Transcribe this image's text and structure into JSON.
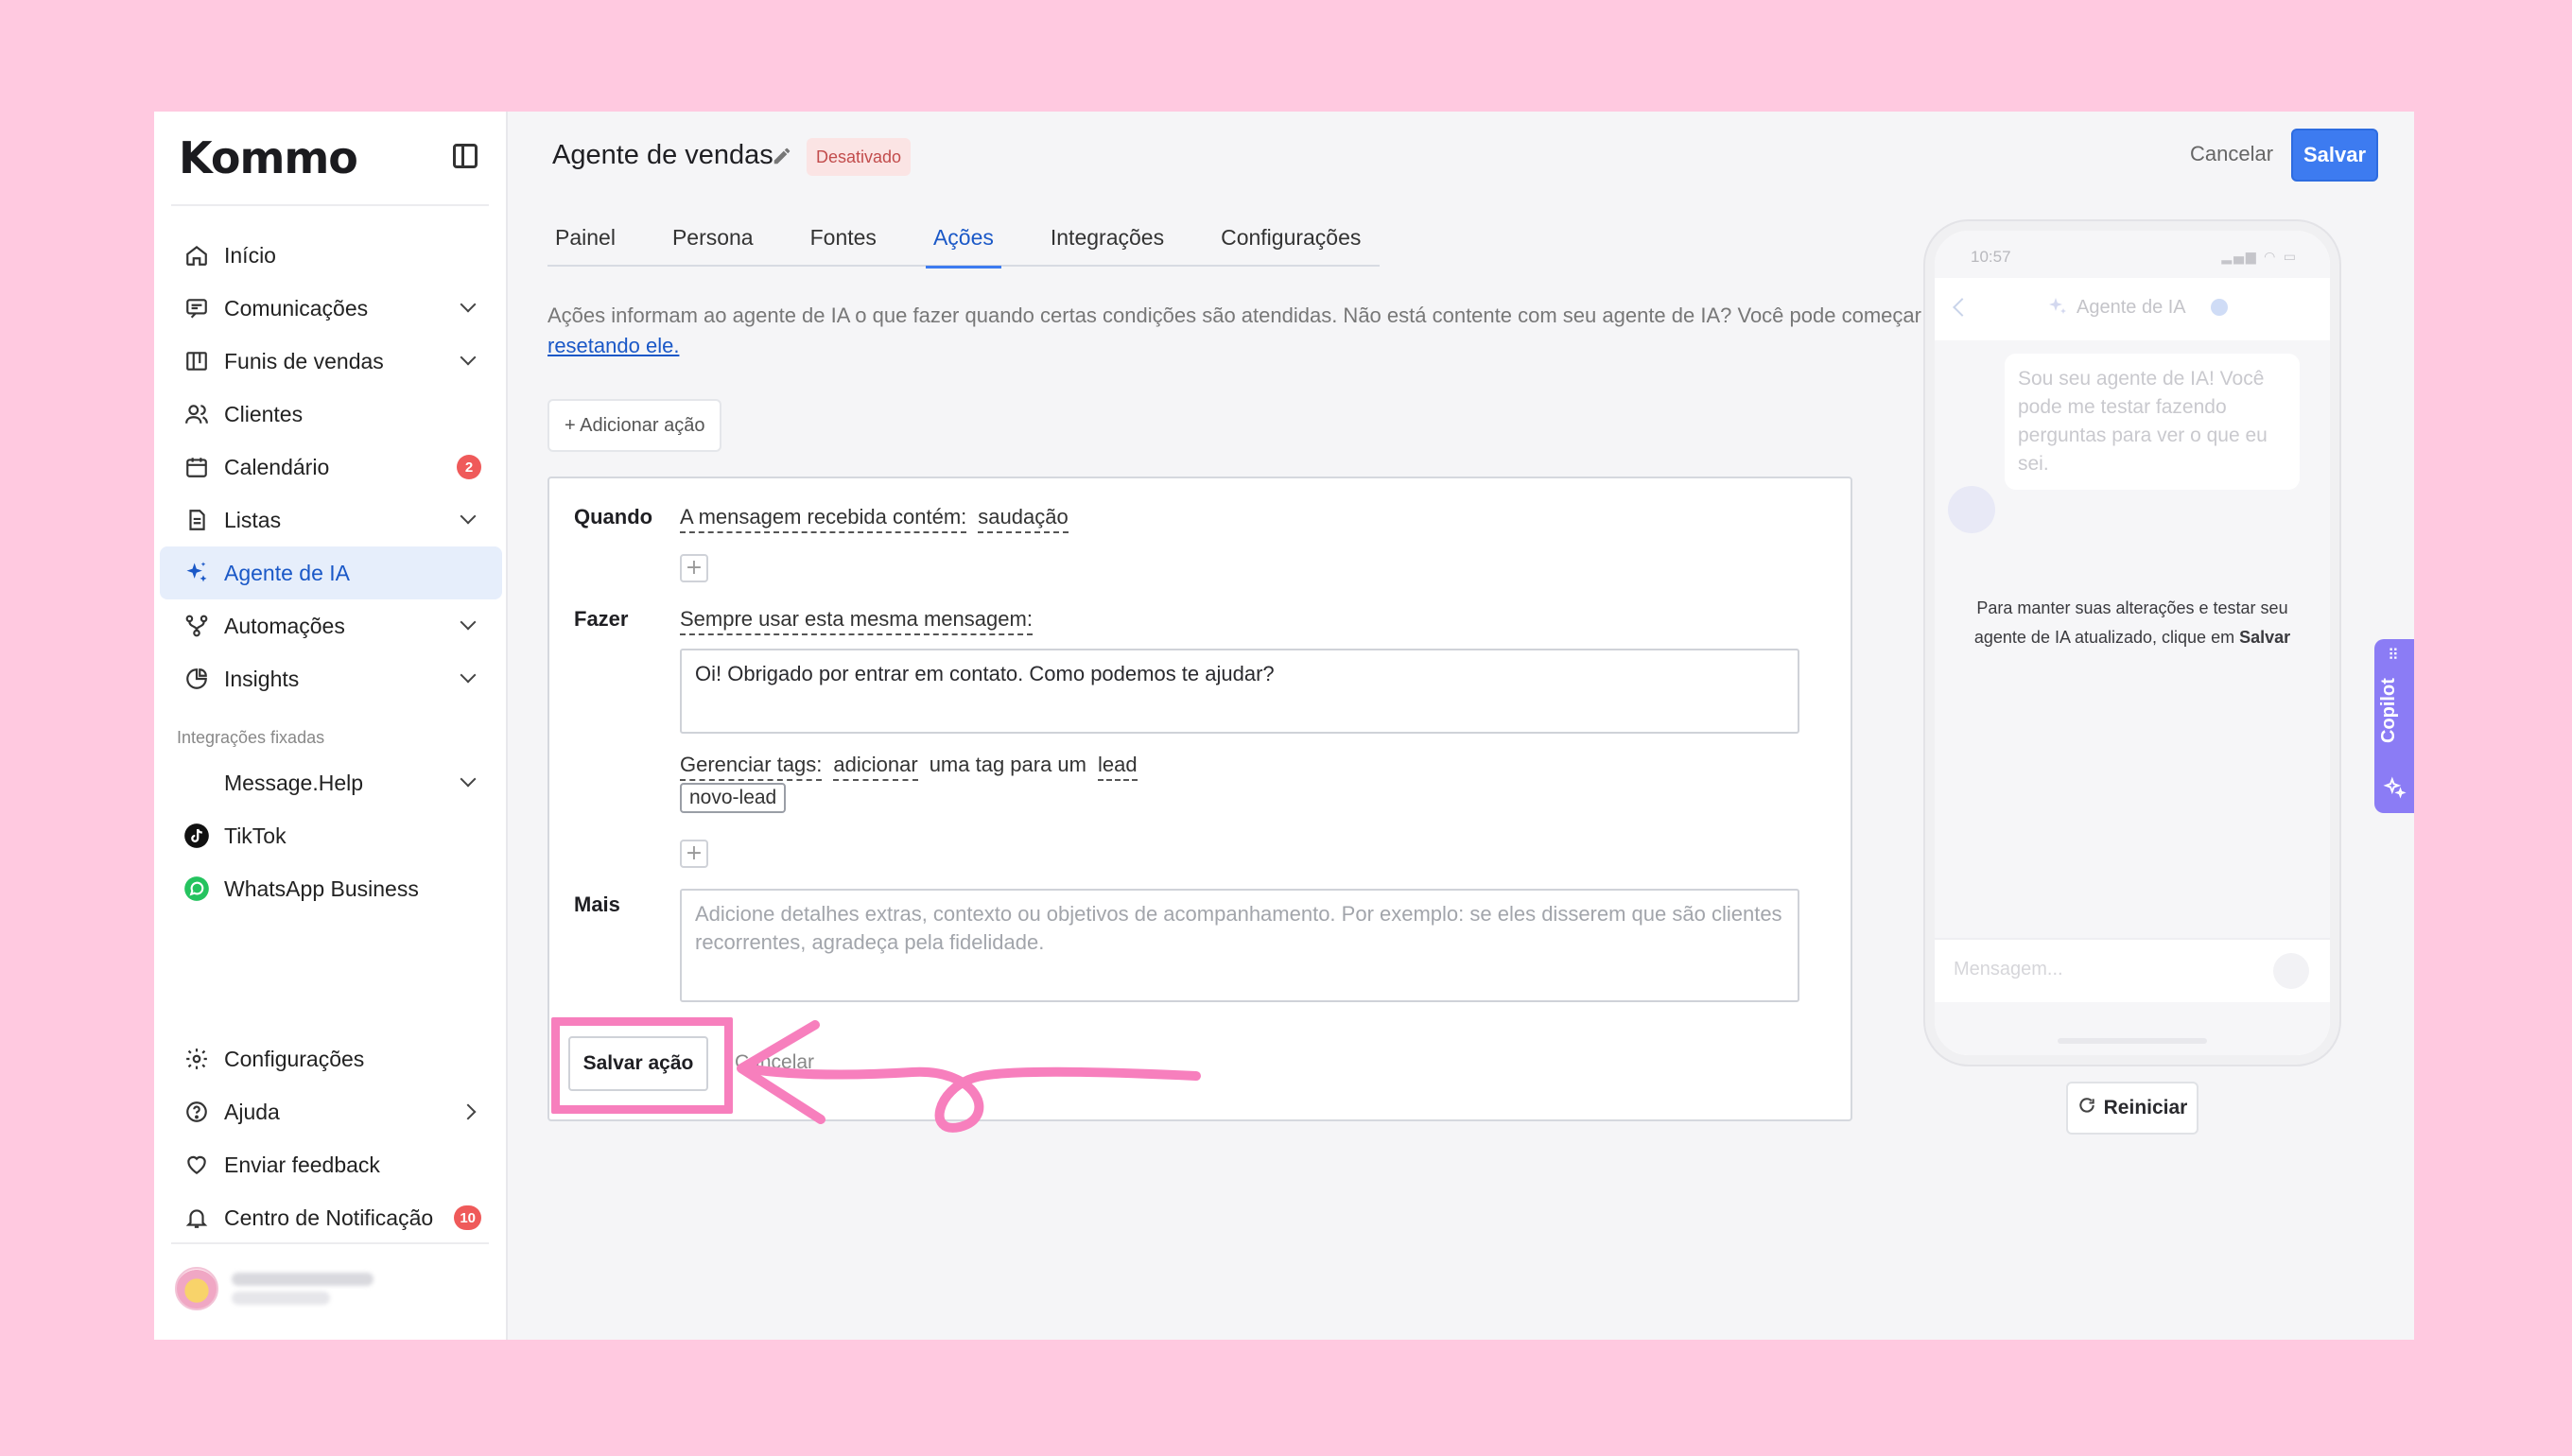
{
  "brand": {
    "logo_text": "Kommo"
  },
  "sidebar": {
    "main_items": [
      {
        "label": "Início",
        "icon": "home-icon"
      },
      {
        "label": "Comunicações",
        "icon": "chat-icon",
        "chevron": true
      },
      {
        "label": "Funis de vendas",
        "icon": "pipeline-icon",
        "chevron": true
      },
      {
        "label": "Clientes",
        "icon": "users-icon"
      },
      {
        "label": "Calendário",
        "icon": "calendar-icon",
        "badge": "2"
      },
      {
        "label": "Listas",
        "icon": "list-icon",
        "chevron": true
      },
      {
        "label": "Agente de IA",
        "icon": "sparkle-icon",
        "active": true
      },
      {
        "label": "Automações",
        "icon": "automation-icon",
        "chevron": true
      },
      {
        "label": "Insights",
        "icon": "pie-chart-icon",
        "chevron": true
      }
    ],
    "pinned_section_label": "Integrações fixadas",
    "pinned_items": [
      {
        "label": "Message.Help",
        "chevron": true
      },
      {
        "label": "TikTok",
        "icon": "tiktok-icon"
      },
      {
        "label": "WhatsApp Business",
        "icon": "whatsapp-icon"
      }
    ],
    "bottom_items": [
      {
        "label": "Configurações",
        "icon": "gear-icon"
      },
      {
        "label": "Ajuda",
        "icon": "help-icon",
        "chevron": true
      },
      {
        "label": "Enviar feedback",
        "icon": "heart-icon"
      },
      {
        "label": "Centro de Notificação",
        "icon": "bell-icon",
        "badge": "10"
      }
    ]
  },
  "header": {
    "title": "Agente de vendas",
    "status": "Desativado",
    "cancel_label": "Cancelar",
    "save_label": "Salvar"
  },
  "tabs": [
    {
      "label": "Painel"
    },
    {
      "label": "Persona"
    },
    {
      "label": "Fontes"
    },
    {
      "label": "Ações",
      "active": true
    },
    {
      "label": "Integrações"
    },
    {
      "label": "Configurações"
    }
  ],
  "description": {
    "text": "Ações informam ao agente de IA o que fazer quando certas condições são atendidas. Não está contente com seu agente de IA? Você pode começar do zero ",
    "link": "resetando ele."
  },
  "add_action_label": "+ Adicionar ação",
  "action_card": {
    "when_label": "Quando",
    "when_condition": "A mensagem recebida contém:",
    "when_value": "saudação",
    "do_label": "Fazer",
    "do_instruction": "Sempre usar esta mesma mensagem:",
    "do_message": "Oi! Obrigado por entrar em contato. Como podemos te ajudar?",
    "tags_label": "Gerenciar tags:",
    "tags_verb": "adicionar",
    "tags_middle": "uma tag para um",
    "tags_target": "lead",
    "tag_chip": "novo-lead",
    "more_label": "Mais",
    "more_placeholder": "Adicione detalhes extras, contexto ou objetivos de acompanhamento. Por exemplo: se eles disserem que são clientes recorrentes, agradeça pela fidelidade.",
    "save_action_label": "Salvar ação",
    "cancel_action_label": "Cancelar"
  },
  "preview": {
    "time": "10:57",
    "title": "Agente de IA",
    "bot_message": "Sou seu agente de IA! Você pode me testar fazendo perguntas para ver o que eu sei.",
    "note_text": "Para manter suas alterações e testar seu agente de IA atualizado, clique em ",
    "note_bold": "Salvar",
    "input_placeholder": "Mensagem...",
    "restart_label": "Reiniciar"
  },
  "copilot": {
    "label": "Copilot"
  },
  "colors": {
    "background": "#ffc9e0",
    "accent": "#3d7bf0",
    "active_nav": "#1a58c7",
    "annotation": "#f77fbd",
    "copilot": "#8b7cf5",
    "badge": "#ef5a5a"
  }
}
